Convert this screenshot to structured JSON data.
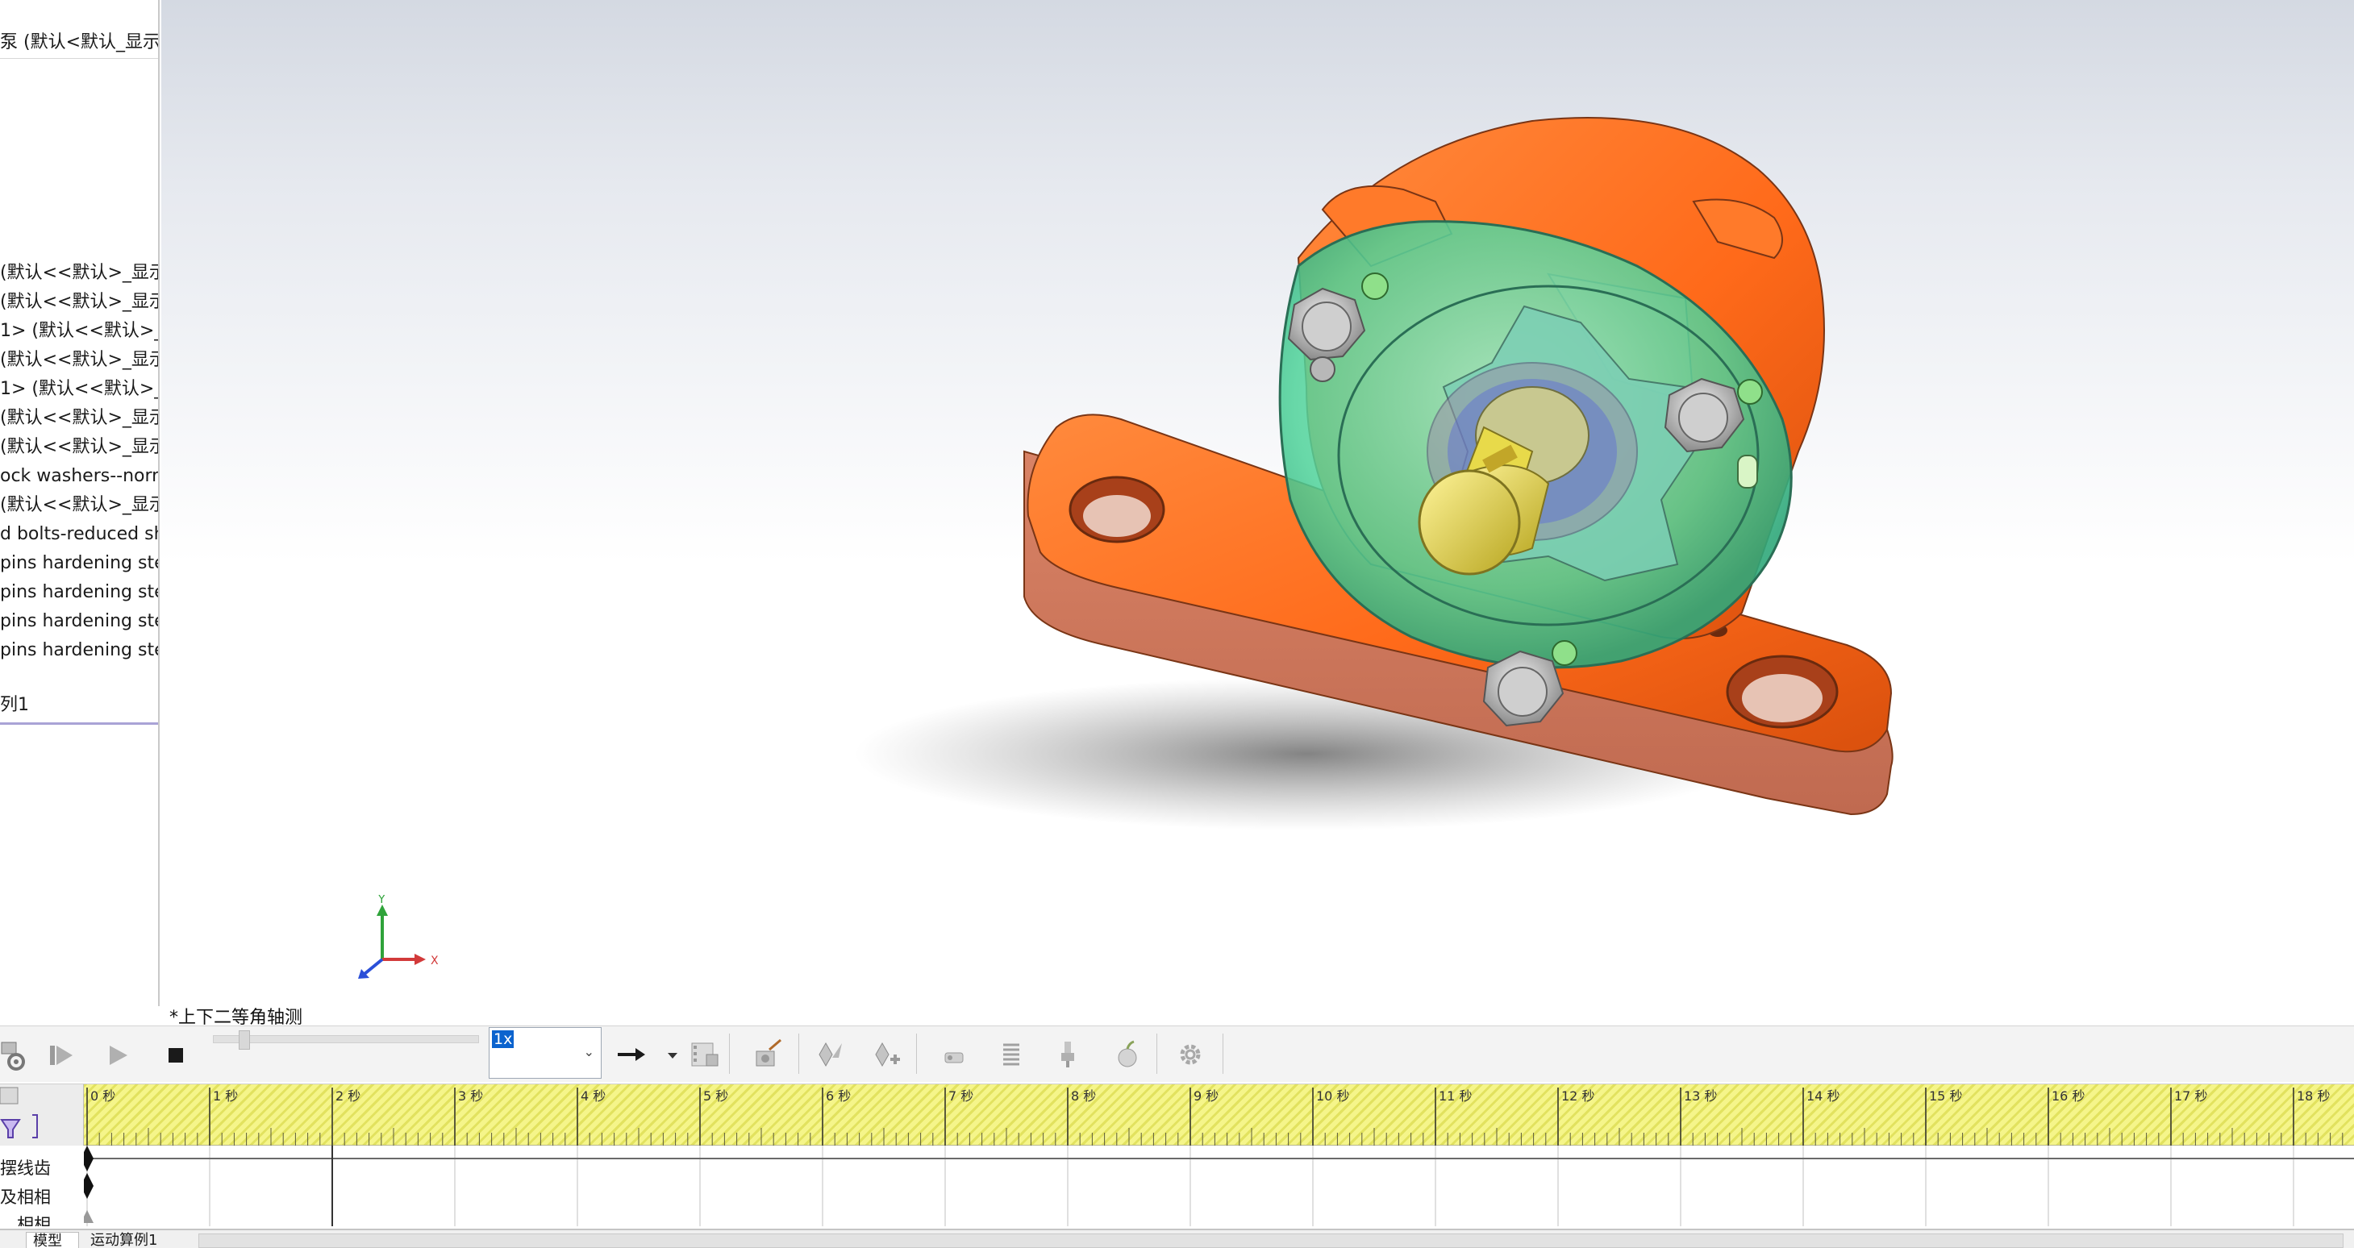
{
  "tree": {
    "root_label": "泵 (默认<默认_显示>",
    "items": [
      "(默认<<默认>_显示",
      "(默认<<默认>_显示",
      "1> (默认<<默认>_显",
      "(默认<<默认>_显示",
      "1> (默认<<默认>_显",
      "(默认<<默认>_显示",
      "(默认<<默认>_显示",
      "ock washers--normal",
      "(默认<<默认>_显示",
      "d bolts-reduced sha",
      "pins hardening stee",
      "pins hardening stee",
      "pins hardening stee",
      "pins hardening stee"
    ],
    "footer_label": "列1",
    "splitter_glyph": "«"
  },
  "viewport": {
    "view_orientation": "*上下二等角轴测",
    "triad": {
      "x": "X",
      "y": "Y"
    }
  },
  "toolbar": {
    "speed_value": "1x",
    "speed_caret": "⌄",
    "icons": [
      "calculate-icon",
      "play-from-start-icon",
      "play-icon",
      "stop-icon",
      "playback-mode-icon",
      "save-animation-icon",
      "animation-wizard-icon",
      "autokey-icon",
      "add-key-icon",
      "motor-icon",
      "spring-icon",
      "damper-icon",
      "gravity-icon",
      "settings-icon"
    ]
  },
  "timeline": {
    "seconds": [
      "0 秒",
      "1 秒",
      "2 秒",
      "3 秒",
      "4 秒",
      "5 秒",
      "6 秒",
      "7 秒",
      "8 秒",
      "9 秒",
      "10 秒",
      "11 秒",
      "12 秒",
      "13 秒",
      "14 秒",
      "15 秒",
      "16 秒",
      "17 秒",
      "18 秒"
    ],
    "rows": [
      "摆线齿",
      "及相相",
      "，相相"
    ],
    "current_time_s": 2,
    "colors": {
      "ruler": "#f5f58a",
      "key": "#111111"
    }
  },
  "tabs": {
    "items": [
      "模型",
      "运动算例1"
    ]
  },
  "colors": {
    "housing": "#ff6a1a",
    "cover": "#4fd39a",
    "shaft": "#d7c83a",
    "accent_blue": "#0b63ce"
  }
}
